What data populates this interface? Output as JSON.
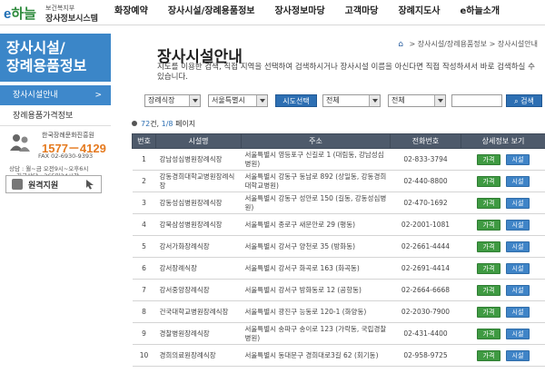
{
  "brand": {
    "logo_text": "e하늘",
    "ministry": "보건복지부",
    "system_name": "장사정보시스템"
  },
  "gnb": [
    "화장예약",
    "장사시설/장례용품정보",
    "장사정보마당",
    "고객마당",
    "장례지도사",
    "e하늘소개"
  ],
  "sidebar": {
    "title_line1": "장사시설/",
    "title_line2": "장례용품정보",
    "items": [
      {
        "label": "장사시설안내",
        "active": true
      },
      {
        "label": "장례용품가격정보",
        "active": false
      }
    ],
    "call": {
      "org": "한국장례문화진흥원",
      "phone": "1577－4129",
      "fax": "FAX 02-6930-9393",
      "hours": "상담 : 월~금 오전9시~오후6시",
      "emergency": "긴급상담 : 365일24시간"
    },
    "remote_label": "원격지원"
  },
  "main": {
    "title": "장사시설안내",
    "breadcrumb": [
      "장사시설/장례용품정보",
      "장사시설안내"
    ],
    "description": "지도를 이용한 검색, 직접 지역을 선택하여 검색하시거나 장사시설 이름을 아신다면 직접 작성하셔서 바로 검색하실 수 있습니다.",
    "filters": {
      "type": "장례식장",
      "region": "서울특별시",
      "select_button": "시도선택",
      "sub1": "전체",
      "sub2": "전체",
      "search_value": "",
      "search_button": "검색"
    },
    "count": {
      "total": "72",
      "total_suffix": "건,",
      "page": "1/8",
      "page_suffix": "페이지"
    },
    "table": {
      "headers": [
        "번호",
        "시설명",
        "주소",
        "전화번호",
        "상세정보 보기"
      ],
      "price_label": "가격",
      "facility_label": "시설",
      "rows": [
        {
          "no": "1",
          "name": "강남성심병원장례식장",
          "addr": "서울특별시 영등포구 신길로 1 (대림동, 강남성심병원)",
          "tel": "02-833-3794"
        },
        {
          "no": "2",
          "name": "강동경희대학교병원장례식장",
          "addr": "서울특별시 강동구 동남로 892 (상일동, 강동경희대학교병원)",
          "tel": "02-440-8800"
        },
        {
          "no": "3",
          "name": "강동성심병원장례식장",
          "addr": "서울특별시 강동구 성안로 150 (길동, 강동성심병원)",
          "tel": "02-470-1692"
        },
        {
          "no": "4",
          "name": "강북삼성병원장례식장",
          "addr": "서울특별시 종로구 새문안로 29 (평동)",
          "tel": "02-2001-1081"
        },
        {
          "no": "5",
          "name": "강서가화장례식장",
          "addr": "서울특별시 강서구 양천로 35 (방화동)",
          "tel": "02-2661-4444"
        },
        {
          "no": "6",
          "name": "강서장례식장",
          "addr": "서울특별시 강서구 화곡로 163 (화곡동)",
          "tel": "02-2691-4414"
        },
        {
          "no": "7",
          "name": "강서중앙장례식장",
          "addr": "서울특별시 강서구 방화동로 12 (공항동)",
          "tel": "02-2664-6668"
        },
        {
          "no": "8",
          "name": "건국대학교병원장례식장",
          "addr": "서울특별시 광진구 능동로 120-1 (화양동)",
          "tel": "02-2030-7900"
        },
        {
          "no": "9",
          "name": "경찰병원장례식장",
          "addr": "서울특별시 송파구 송이로 123 (가락동, 국립경찰병원)",
          "tel": "02-431-4400"
        },
        {
          "no": "10",
          "name": "경희의료원장례식장",
          "addr": "서울특별시 동대문구 경희대로3길 62 (회기동)",
          "tel": "02-958-9725"
        }
      ]
    }
  },
  "colors": {
    "brand_blue": "#3b86c8",
    "header_dark": "#4e5a6b",
    "price_green": "#3f9a42",
    "facility_blue": "#3f84c7"
  }
}
